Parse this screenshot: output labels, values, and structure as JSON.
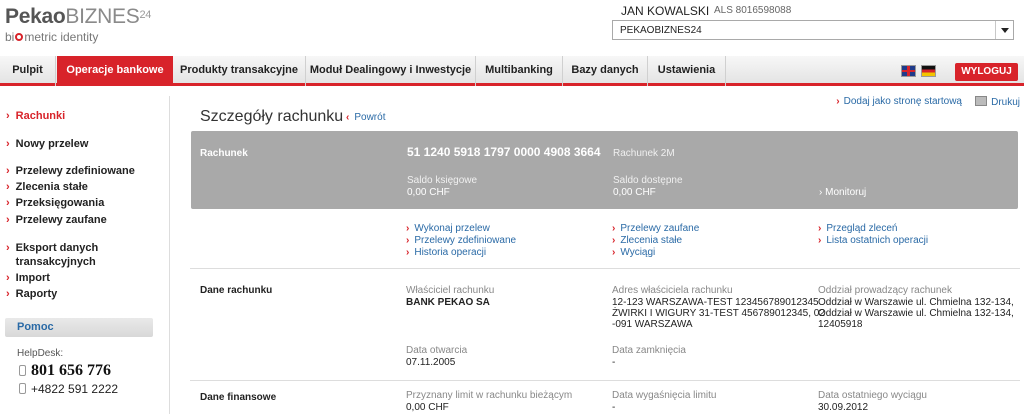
{
  "header": {
    "logo_pekao": "Pekao",
    "logo_biznes": "BIZNES",
    "logo_sup": "24",
    "logo_sub_pre": "bi",
    "logo_sub_post": "metric identity",
    "user_name": "JAN KOWALSKI",
    "user_id": "ALS 8016598088",
    "account_selector": {
      "value": "PEKAOBIZNES24"
    }
  },
  "nav": {
    "tabs": [
      {
        "label": "Pulpit"
      },
      {
        "label": "Operacje bankowe"
      },
      {
        "label": "Produkty transakcyjne"
      },
      {
        "label": "Moduł Dealingowy i Inwestycje"
      },
      {
        "label": "Multibanking"
      },
      {
        "label": "Bazy danych"
      },
      {
        "label": "Ustawienia"
      }
    ],
    "logout_label": "WYLOGUJ"
  },
  "sidebar": {
    "items": [
      {
        "label": "Rachunki"
      },
      {
        "label": "Nowy przelew"
      },
      {
        "label": "Przelewy zdefiniowane"
      },
      {
        "label": "Zlecenia stałe"
      },
      {
        "label": "Przeksięgowania"
      },
      {
        "label": "Przelewy zaufane"
      },
      {
        "label_line1": "Eksport danych",
        "label_line2": "transakcyjnych"
      },
      {
        "label": "Import"
      },
      {
        "label": "Raporty"
      }
    ],
    "help_title": "Pomoc",
    "helpdesk_label": "HelpDesk:",
    "phone_main": "801 656 776",
    "phone_secondary": "+4822 591 2222"
  },
  "main": {
    "add_to_start": "Dodaj jako stronę startową",
    "print": "Drukuj",
    "title": "Szczegóły rachunku",
    "back": "Powrót",
    "account": {
      "label": "Rachunek",
      "number": "51 1240 5918 1797 0000 4908 3664",
      "name": "Rachunek 2M",
      "book_balance_label": "Saldo księgowe",
      "book_balance": "0,00 CHF",
      "available_balance_label": "Saldo dostępne",
      "available_balance": "0,00 CHF",
      "monitor": "Monitoruj"
    },
    "actions": {
      "col1": [
        "Wykonaj przelew",
        "Przelewy zdefiniowane",
        "Historia operacji"
      ],
      "col2": [
        "Przelewy zaufane",
        "Zlecenia stałe",
        "Wyciągi"
      ],
      "col3": [
        "Przegląd zleceń",
        "Lista ostatnich operacji"
      ]
    },
    "details": {
      "title": "Dane rachunku",
      "owner_label": "Właściciel rachunku",
      "owner_value": "BANK PEKAO SA",
      "owner_address_label": "Adres właściciela rachunku",
      "owner_address_lines": [
        "12-123 WARSZAWA-TEST 123456789012345",
        "ŻWIRKI I WIGURY 31-TEST 456789012345, 02",
        "-091 WARSZAWA"
      ],
      "branch_label": "Oddział prowadzący rachunek",
      "branch_lines": [
        "Oddział w Warszawie ul. Chmielna 132-134,",
        "Oddział w Warszawie ul. Chmielna 132-134,",
        "12405918"
      ],
      "opened_label": "Data otwarcia",
      "opened_value": "07.11.2005",
      "closed_label": "Data zamknięcia",
      "closed_value": "-"
    },
    "financial": {
      "title": "Dane finansowe",
      "limit_label": "Przyznany limit w rachunku bieżącym",
      "limit_value": "0,00 CHF",
      "limit_expiry_label": "Data wygaśnięcia limitu",
      "limit_expiry_value": "-",
      "last_statement_label": "Data ostatniego wyciągu",
      "last_statement_value": "30.09.2012"
    }
  }
}
